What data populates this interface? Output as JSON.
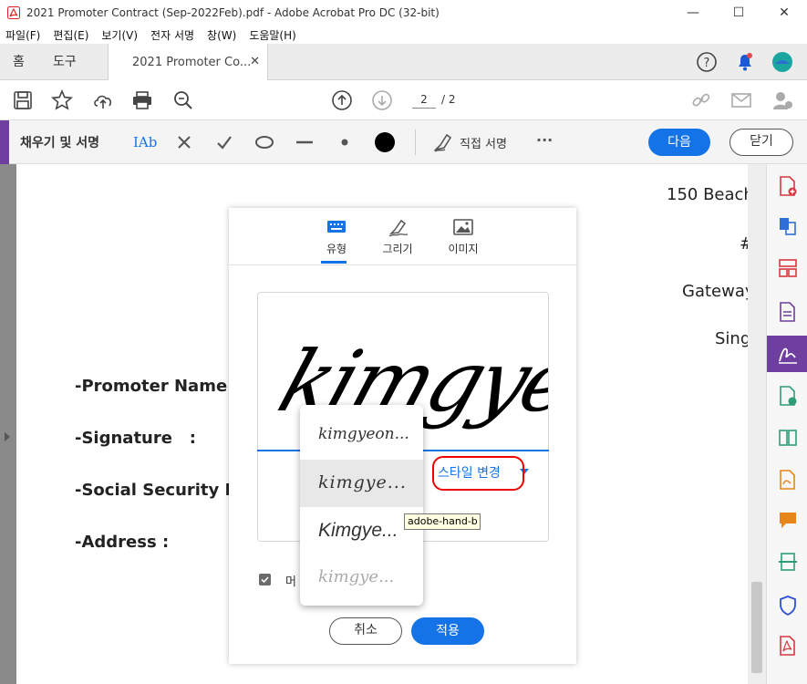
{
  "window": {
    "title": "2021 Promoter Contract (Sep-2022Feb).pdf - Adobe Acrobat Pro DC (32-bit)",
    "app_icon": "acrobat-icon",
    "controls": [
      "—",
      "☐",
      "✕"
    ]
  },
  "menu": {
    "items": [
      "파일(F)",
      "편집(E)",
      "보기(V)",
      "전자 서명",
      "창(W)",
      "도움말(H)"
    ]
  },
  "tabs": {
    "home": "홈",
    "tools": "도구",
    "document": "2021 Promoter Co...",
    "close": "✕"
  },
  "toolbar": {
    "page_current": "2",
    "page_total": "/ 2"
  },
  "signbar": {
    "title": "채우기 및 서명",
    "text_tool": "IAb",
    "direct_sign": "직접 서명",
    "more": "···",
    "next": "다음",
    "close": "닫기"
  },
  "document": {
    "right_lines": [
      "150 Beach",
      "#",
      "Gateway",
      "Sing"
    ],
    "fields": [
      "-Promoter Name (",
      "-Signature   :",
      "-Social Security Nu",
      "-Address :"
    ]
  },
  "dialog": {
    "tabs": [
      {
        "label": "유형",
        "icon": "keyboard-icon"
      },
      {
        "label": "그리기",
        "icon": "pen-draw-icon"
      },
      {
        "label": "이미지",
        "icon": "image-icon"
      }
    ],
    "signature_text": "kimgyeon",
    "style_change": "스타일 변경",
    "save_checkbox_label": "머",
    "cancel": "취소",
    "apply": "적용"
  },
  "style_menu": {
    "options": [
      "kimgyeon...",
      "kimgye...",
      "Kimgye...",
      "kimgye..."
    ],
    "hovered_index": 1,
    "tooltip": "adobe-hand-b"
  },
  "colors": {
    "accent_blue": "#1473e6",
    "fill_sign_purple": "#6f3fa0",
    "highlight_red": "#e00000"
  }
}
